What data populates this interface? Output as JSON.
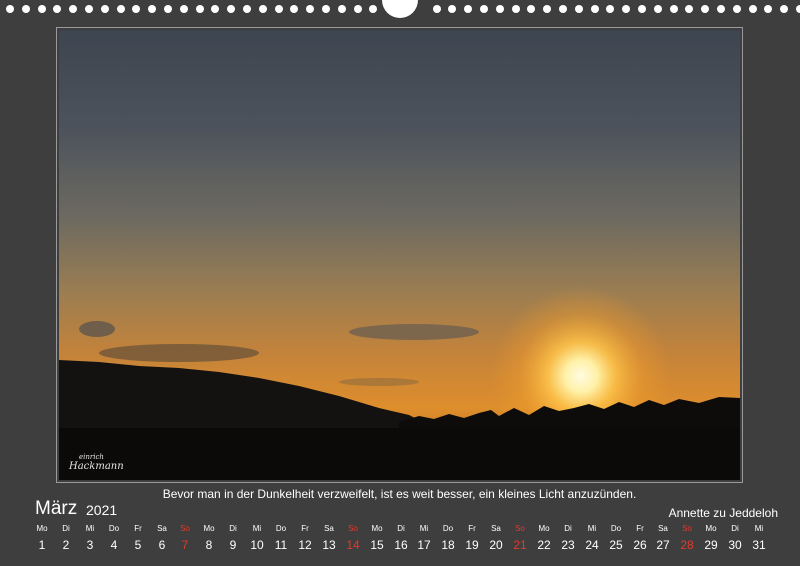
{
  "quote": "Bevor man in der Dunkelheit verzweifelt, ist es weit besser, ein kleines Licht anzuzünden.",
  "month": "März",
  "year": "2021",
  "author": "Annette zu Jeddeloh",
  "signature": {
    "line1": "einrich",
    "line2": "Hackmann"
  },
  "colors": {
    "background": "#3e3e3e",
    "text": "#ffffff",
    "sunday": "#e23a2e"
  },
  "days": [
    {
      "name": "Mo",
      "num": "1"
    },
    {
      "name": "Di",
      "num": "2"
    },
    {
      "name": "Mi",
      "num": "3"
    },
    {
      "name": "Do",
      "num": "4"
    },
    {
      "name": "Fr",
      "num": "5"
    },
    {
      "name": "Sa",
      "num": "6"
    },
    {
      "name": "So",
      "num": "7",
      "sunday": true
    },
    {
      "name": "Mo",
      "num": "8"
    },
    {
      "name": "Di",
      "num": "9"
    },
    {
      "name": "Mi",
      "num": "10"
    },
    {
      "name": "Do",
      "num": "11"
    },
    {
      "name": "Fr",
      "num": "12"
    },
    {
      "name": "Sa",
      "num": "13"
    },
    {
      "name": "So",
      "num": "14",
      "sunday": true
    },
    {
      "name": "Mo",
      "num": "15"
    },
    {
      "name": "Di",
      "num": "16"
    },
    {
      "name": "Mi",
      "num": "17"
    },
    {
      "name": "Do",
      "num": "18"
    },
    {
      "name": "Fr",
      "num": "19"
    },
    {
      "name": "Sa",
      "num": "20"
    },
    {
      "name": "So",
      "num": "21",
      "sunday": true
    },
    {
      "name": "Mo",
      "num": "22"
    },
    {
      "name": "Di",
      "num": "23"
    },
    {
      "name": "Mi",
      "num": "24"
    },
    {
      "name": "Do",
      "num": "25"
    },
    {
      "name": "Fr",
      "num": "26"
    },
    {
      "name": "Sa",
      "num": "27"
    },
    {
      "name": "So",
      "num": "28",
      "sunday": true
    },
    {
      "name": "Mo",
      "num": "29"
    },
    {
      "name": "Di",
      "num": "30"
    },
    {
      "name": "Mi",
      "num": "31"
    }
  ]
}
